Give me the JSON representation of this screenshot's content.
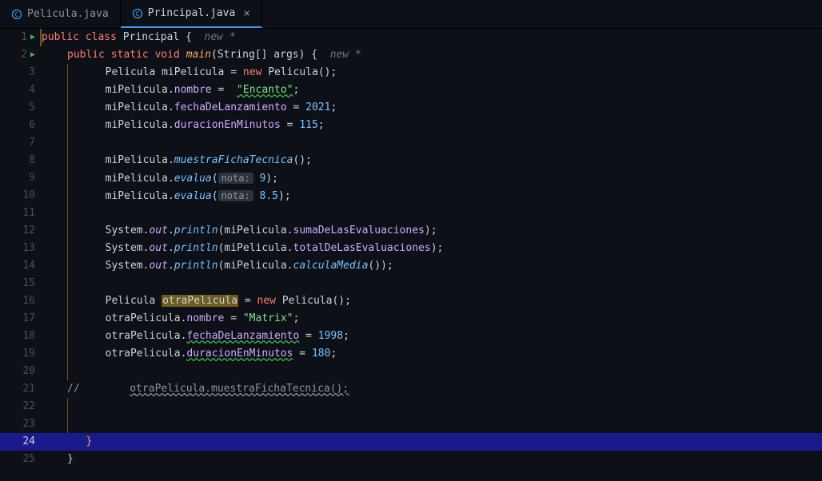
{
  "tabs": [
    {
      "name": "Pelicula.java",
      "active": false
    },
    {
      "name": "Principal.java",
      "active": true
    }
  ],
  "current_line": 24,
  "gutter": {
    "run_lines": [
      1,
      2
    ]
  },
  "code": {
    "l1": {
      "kw1": "public class ",
      "cls": "Principal",
      "brace": " {",
      "inlay": "  new *"
    },
    "l2": {
      "kw1": "public static ",
      "kw2": "void ",
      "m": "main",
      "params": "(String[] args)",
      "brace": " {",
      "inlay": "  new *"
    },
    "l3": {
      "type": "Pelicula ",
      "var": "miPelicula",
      "eq": " = ",
      "kw": "new ",
      "ctor": "Pelicula",
      "tail": "();"
    },
    "l4": {
      "var": "miPelicula",
      "dot": ".",
      "field": "nombre",
      "eq": " =  ",
      "str": "\"Encanto\"",
      "tail": ";"
    },
    "l5": {
      "var": "miPelicula",
      "dot": ".",
      "field": "fechaDeLanzamiento",
      "eq": " = ",
      "num": "2021",
      "tail": ";"
    },
    "l6": {
      "var": "miPelicula",
      "dot": ".",
      "field": "duracionEnMinutos",
      "eq": " = ",
      "num": "115",
      "tail": ";"
    },
    "l8": {
      "var": "miPelicula",
      "dot": ".",
      "call": "muestraFichaTecnica",
      "tail": "();"
    },
    "l9": {
      "var": "miPelicula",
      "dot": ".",
      "call": "evalua",
      "open": "(",
      "hint": "nota:",
      "num": " 9",
      "close": ");"
    },
    "l10": {
      "var": "miPelicula",
      "dot": ".",
      "call": "evalua",
      "open": "(",
      "hint": "nota:",
      "num": " 8.5",
      "close": ");"
    },
    "l12": {
      "sys": "System",
      "dot1": ".",
      "out": "out",
      "dot2": ".",
      "call": "println",
      "open": "(",
      "var": "miPelicula",
      "dot3": ".",
      "field": "sumaDeLasEvaluaciones",
      "close": ");"
    },
    "l13": {
      "sys": "System",
      "dot1": ".",
      "out": "out",
      "dot2": ".",
      "call": "println",
      "open": "(",
      "var": "miPelicula",
      "dot3": ".",
      "field": "totalDeLasEvaluaciones",
      "close": ");"
    },
    "l14": {
      "sys": "System",
      "dot1": ".",
      "out": "out",
      "dot2": ".",
      "call": "println",
      "open": "(",
      "var": "miPelicula",
      "dot3": ".",
      "call2": "calculaMedia",
      "close": "());"
    },
    "l16": {
      "type": "Pelicula ",
      "var": "otraPelicula",
      "eq": " = ",
      "kw": "new ",
      "ctor": "Pelicula",
      "tail": "();"
    },
    "l17": {
      "var": "otraPelicula",
      "dot": ".",
      "field": "nombre",
      "eq": " = ",
      "str": "\"Matrix\"",
      "tail": ";"
    },
    "l18": {
      "var": "otraPelicula",
      "dot": ".",
      "field": "fechaDeLanzamiento",
      "eq": " = ",
      "num": "1998",
      "tail": ";"
    },
    "l19": {
      "var": "otraPelicula",
      "dot": ".",
      "field": "duracionEnMinutos",
      "eq": " = ",
      "num": "180",
      "tail": ";"
    },
    "l21": {
      "comment": "//        ",
      "rest": "otraPelicula.muestraFichaTecnica();"
    },
    "l24": {
      "brace": "}"
    },
    "l25": {
      "brace": "}"
    }
  }
}
